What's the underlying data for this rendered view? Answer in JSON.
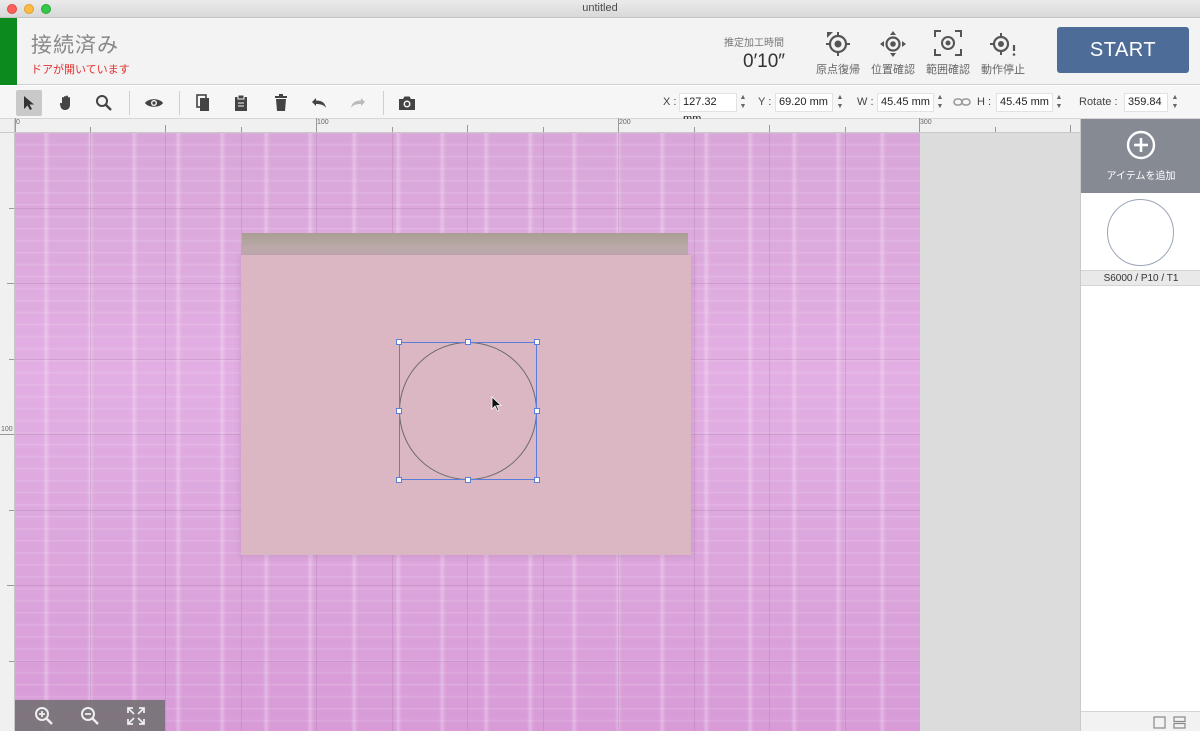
{
  "window": {
    "title": "untitled"
  },
  "status": {
    "connection": "接続済み",
    "door_message": "ドアが開いています",
    "strip_color": "#0c8a1e"
  },
  "estimate": {
    "label": "推定加工時間",
    "time": "0′10″"
  },
  "header_buttons": [
    {
      "label": "原点復帰",
      "icon": "home-target-icon"
    },
    {
      "label": "位置確認",
      "icon": "move-target-icon"
    },
    {
      "label": "範囲確認",
      "icon": "frame-target-icon"
    },
    {
      "label": "動作停止",
      "icon": "stop-target-icon"
    }
  ],
  "start_button": {
    "label": "START",
    "color": "#4d6d98"
  },
  "toolbar": {
    "tools": [
      "select-arrow-icon",
      "hand-pan-icon",
      "zoom-icon",
      "preview-eye-icon",
      "copy-icon",
      "paste-icon",
      "delete-icon",
      "undo-icon",
      "redo-icon",
      "camera-icon"
    ]
  },
  "transform": {
    "x_label": "X :",
    "x_value": "127.32 mm",
    "y_label": "Y :",
    "y_value": "69.20 mm",
    "w_label": "W :",
    "w_value": "45.45 mm",
    "h_label": "H :",
    "h_value": "45.45 mm",
    "rotate_label": "Rotate :",
    "rotate_value": "359.84"
  },
  "rulers": {
    "top_labels": [
      "0",
      "100",
      "200",
      "300"
    ],
    "left_labels": [
      "100"
    ]
  },
  "right_panel": {
    "add_label": "アイテムを追加",
    "items": [
      {
        "label": "S6000 / P10 / T1",
        "shape": "circle"
      }
    ]
  },
  "zoom_controls": [
    "zoom-in-icon",
    "zoom-out-icon",
    "fit-screen-icon"
  ]
}
